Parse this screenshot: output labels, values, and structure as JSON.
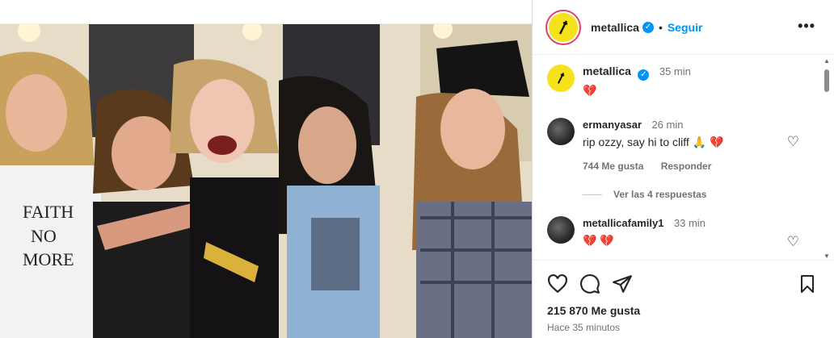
{
  "post": {
    "account": "metallica",
    "follow_label": "Seguir",
    "more_label": "•••",
    "caption_user": "metallica",
    "caption_time": "35 min",
    "caption_text": "💔"
  },
  "comments": [
    {
      "user": "ermanyasar",
      "time": "26 min",
      "text": "rip ozzy, say hi to cliff 🙏 💔",
      "likes": "744 Me gusta",
      "reply": "Responder"
    },
    {
      "user": "metallicafamily1",
      "time": "33 min",
      "text": "💔 💔"
    }
  ],
  "view_replies": "Ver las 4 respuestas",
  "footer": {
    "likes": "215 870 Me gusta",
    "time_ago": "Hace 35 minutos"
  },
  "photo": {
    "shirt_text": [
      "FAITH",
      "NO",
      "MORE"
    ]
  },
  "colors": {
    "accent": "#0095f6",
    "avatar_bg": "#f6e21a",
    "ring": "#e0406a"
  },
  "icons": [
    "verified-icon",
    "heart-icon",
    "comment-icon",
    "share-icon",
    "bookmark-icon",
    "more-icon"
  ]
}
